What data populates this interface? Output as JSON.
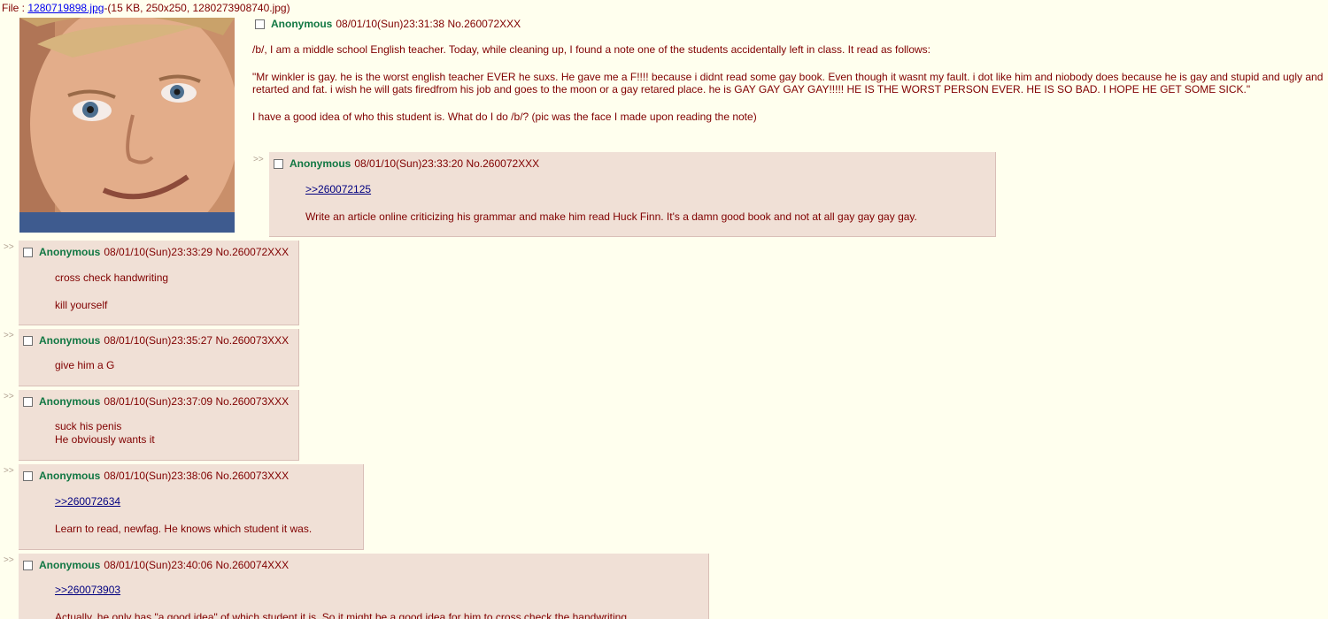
{
  "file": {
    "prefix": "File : ",
    "link": "1280719898.jpg",
    "details": "-(15 KB, 250x250, 1280273908740.jpg)"
  },
  "op": {
    "name": "Anonymous",
    "meta": "08/01/10(Sun)23:31:38 No.260072XXX",
    "paragraphs": [
      "/b/, I am a middle school English teacher. Today, while cleaning up, I found a note one of the students accidentally left in class. It read as follows:",
      "\"Mr winkler is gay. he is the worst english teacher EVER he suxs. He gave me a F!!!! because i didnt read some gay book. Even though it wasnt my fault. i dot like him and niobody does because he is gay and stupid and ugly and retarted and fat. i wish he will gats firedfrom his job and goes to the moon or a gay retared place. he is GAY GAY GAY GAY!!!!! HE IS THE WORST PERSON EVER. HE IS SO BAD. I HOPE HE GET SOME SICK.\"",
      "I have a good idea of who this student is. What do I do /b/? (pic was the face I made upon reading the note)"
    ]
  },
  "arrows": ">>",
  "replies": [
    {
      "name": "Anonymous",
      "meta": "08/01/10(Sun)23:33:20 No.260072XXX",
      "quote": ">>260072125",
      "lines": [
        "Write an article online criticizing his grammar and make him read Huck Finn. It's a damn good book and not at all gay gay gay gay."
      ]
    },
    {
      "name": "Anonymous",
      "meta": "08/01/10(Sun)23:33:29 No.260072XXX",
      "lines": [
        "cross check handwriting",
        "kill yourself"
      ]
    },
    {
      "name": "Anonymous",
      "meta": "08/01/10(Sun)23:35:27 No.260073XXX",
      "lines": [
        "give him a G"
      ]
    },
    {
      "name": "Anonymous",
      "meta": "08/01/10(Sun)23:37:09 No.260073XXX",
      "lines": [
        "suck his penis",
        "He obviously wants it"
      ]
    },
    {
      "name": "Anonymous",
      "meta": "08/01/10(Sun)23:38:06 No.260073XXX",
      "quote": ">>260072634",
      "lines": [
        "Learn to read, newfag. He knows which student it was."
      ]
    },
    {
      "name": "Anonymous",
      "meta": "08/01/10(Sun)23:40:06 No.260074XXX",
      "quote": ">>260073903",
      "lines": [
        "Actually, he only has \"a good idea\" of which student it is. So it might be a good idea for him to cross check the handwriting."
      ]
    }
  ]
}
